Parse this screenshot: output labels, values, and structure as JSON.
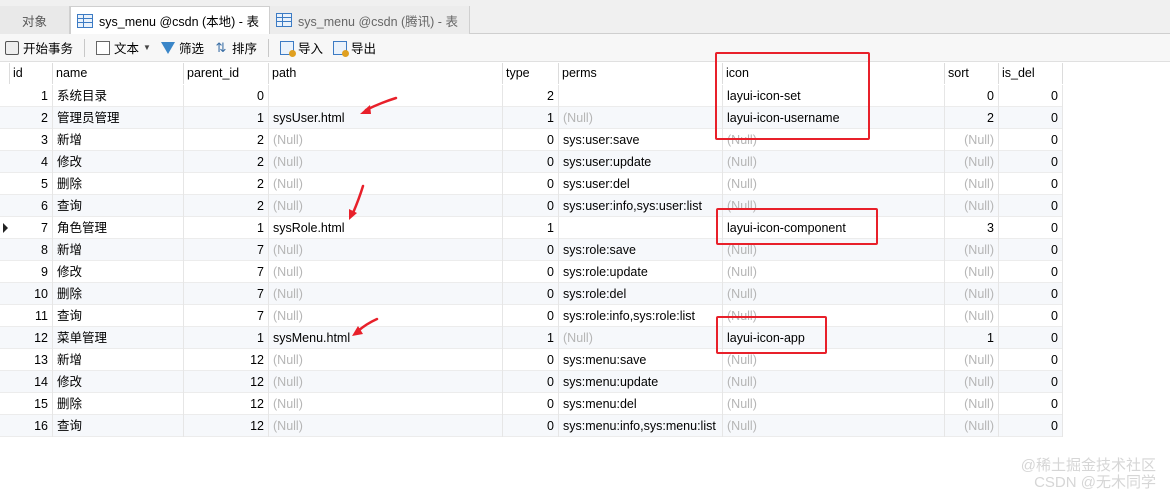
{
  "tabs": [
    {
      "label": "对象"
    },
    {
      "label": "sys_menu @csdn (本地) - 表"
    },
    {
      "label": "sys_menu @csdn (腾讯) - 表"
    }
  ],
  "toolbar": {
    "begin_transaction": "开始事务",
    "text": "文本",
    "filter": "筛选",
    "sort": "排序",
    "import": "导入",
    "export": "导出"
  },
  "columns": [
    "id",
    "name",
    "parent_id",
    "path",
    "type",
    "perms",
    "icon",
    "sort",
    "is_del"
  ],
  "rows": [
    {
      "id": "1",
      "name": "系统目录",
      "parent_id": "0",
      "path": "",
      "type": "2",
      "perms": "",
      "icon": "layui-icon-set",
      "sort": "0",
      "is_del": "0"
    },
    {
      "id": "2",
      "name": "管理员管理",
      "parent_id": "1",
      "path": "sysUser.html",
      "type": "1",
      "perms": "(Null)",
      "icon": "layui-icon-username",
      "sort": "2",
      "is_del": "0"
    },
    {
      "id": "3",
      "name": "新增",
      "parent_id": "2",
      "path": "(Null)",
      "type": "0",
      "perms": "sys:user:save",
      "icon": "(Null)",
      "sort": "(Null)",
      "is_del": "0"
    },
    {
      "id": "4",
      "name": "修改",
      "parent_id": "2",
      "path": "(Null)",
      "type": "0",
      "perms": "sys:user:update",
      "icon": "(Null)",
      "sort": "(Null)",
      "is_del": "0"
    },
    {
      "id": "5",
      "name": "删除",
      "parent_id": "2",
      "path": "(Null)",
      "type": "0",
      "perms": "sys:user:del",
      "icon": "(Null)",
      "sort": "(Null)",
      "is_del": "0"
    },
    {
      "id": "6",
      "name": "查询",
      "parent_id": "2",
      "path": "(Null)",
      "type": "0",
      "perms": "sys:user:info,sys:user:list",
      "icon": "(Null)",
      "sort": "(Null)",
      "is_del": "0"
    },
    {
      "id": "7",
      "name": "角色管理",
      "parent_id": "1",
      "path": "sysRole.html",
      "type": "1",
      "perms": "",
      "icon": "layui-icon-component",
      "sort": "3",
      "is_del": "0"
    },
    {
      "id": "8",
      "name": "新增",
      "parent_id": "7",
      "path": "(Null)",
      "type": "0",
      "perms": "sys:role:save",
      "icon": "(Null)",
      "sort": "(Null)",
      "is_del": "0"
    },
    {
      "id": "9",
      "name": "修改",
      "parent_id": "7",
      "path": "(Null)",
      "type": "0",
      "perms": "sys:role:update",
      "icon": "(Null)",
      "sort": "(Null)",
      "is_del": "0"
    },
    {
      "id": "10",
      "name": "删除",
      "parent_id": "7",
      "path": "(Null)",
      "type": "0",
      "perms": "sys:role:del",
      "icon": "(Null)",
      "sort": "(Null)",
      "is_del": "0"
    },
    {
      "id": "11",
      "name": "查询",
      "parent_id": "7",
      "path": "(Null)",
      "type": "0",
      "perms": "sys:role:info,sys:role:list",
      "icon": "(Null)",
      "sort": "(Null)",
      "is_del": "0"
    },
    {
      "id": "12",
      "name": "菜单管理",
      "parent_id": "1",
      "path": "sysMenu.html",
      "type": "1",
      "perms": "(Null)",
      "icon": "layui-icon-app",
      "sort": "1",
      "is_del": "0"
    },
    {
      "id": "13",
      "name": "新增",
      "parent_id": "12",
      "path": "(Null)",
      "type": "0",
      "perms": "sys:menu:save",
      "icon": "(Null)",
      "sort": "(Null)",
      "is_del": "0"
    },
    {
      "id": "14",
      "name": "修改",
      "parent_id": "12",
      "path": "(Null)",
      "type": "0",
      "perms": "sys:menu:update",
      "icon": "(Null)",
      "sort": "(Null)",
      "is_del": "0"
    },
    {
      "id": "15",
      "name": "删除",
      "parent_id": "12",
      "path": "(Null)",
      "type": "0",
      "perms": "sys:menu:del",
      "icon": "(Null)",
      "sort": "(Null)",
      "is_del": "0"
    },
    {
      "id": "16",
      "name": "查询",
      "parent_id": "12",
      "path": "(Null)",
      "type": "0",
      "perms": "sys:menu:info,sys:menu:list",
      "icon": "(Null)",
      "sort": "(Null)",
      "is_del": "0"
    }
  ],
  "selected_row_id": "7",
  "colors": {
    "highlight": "#e8202a",
    "null_text": "#b5b5b5"
  },
  "watermark": [
    "@稀土掘金技术社区",
    "CSDN @无木同学"
  ]
}
